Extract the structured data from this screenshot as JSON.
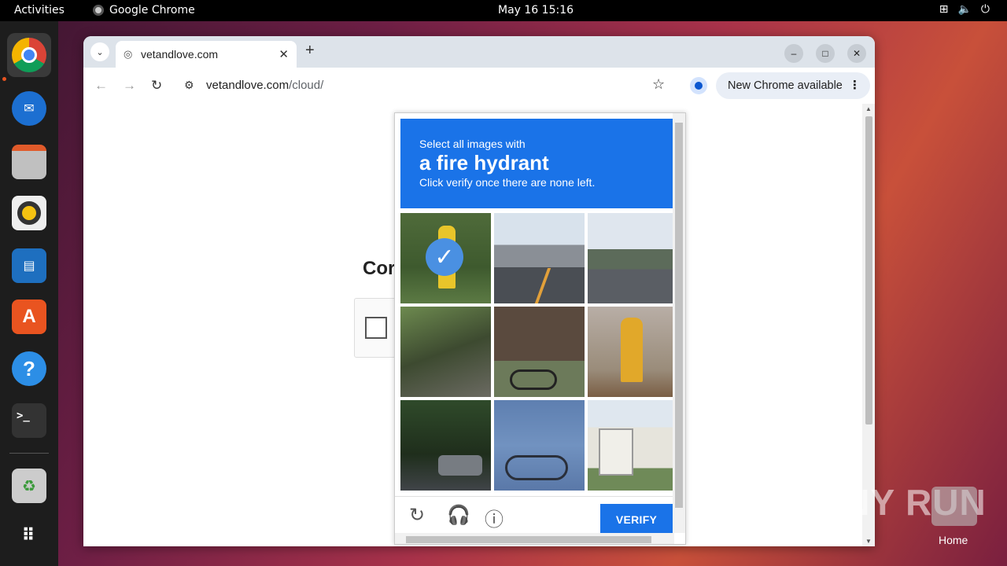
{
  "topbar": {
    "activities": "Activities",
    "app_name": "Google Chrome",
    "clock": "May 16  15:16",
    "tray_icons": [
      "network-icon",
      "volume-icon",
      "power-icon"
    ]
  },
  "dock": {
    "items": [
      "chrome-icon",
      "thunderbird-icon",
      "files-icon",
      "rhythmbox-icon",
      "libreoffice-writer-icon",
      "app-center-icon",
      "help-icon",
      "terminal-icon",
      "trash-icon",
      "app-grid-icon"
    ]
  },
  "browser": {
    "tab_title": "vetandlove.com",
    "url_host": "vetandlove.com",
    "url_path": "/cloud/",
    "update_label": "New Chrome available"
  },
  "page": {
    "heading_partial": "Cor"
  },
  "captcha": {
    "line1": "Select all images with",
    "line2": "a fire hydrant",
    "line3": "Click verify once there are none left.",
    "verify_label": "VERIFY",
    "tiles": [
      {
        "desc": "yellow fire hydrant in grass",
        "selected": true
      },
      {
        "desc": "street with cars",
        "selected": false
      },
      {
        "desc": "road with wall",
        "selected": false
      },
      {
        "desc": "stairs with plants",
        "selected": false
      },
      {
        "desc": "bicycle by building",
        "selected": false
      },
      {
        "desc": "yellow fire hydrant on ground",
        "selected": false
      },
      {
        "desc": "street with car and trees",
        "selected": false
      },
      {
        "desc": "bicycle by blue wall",
        "selected": false
      },
      {
        "desc": "house with fence",
        "selected": false
      }
    ]
  },
  "desktop": {
    "watermark": "ANY RUN",
    "home_label": "Home"
  }
}
